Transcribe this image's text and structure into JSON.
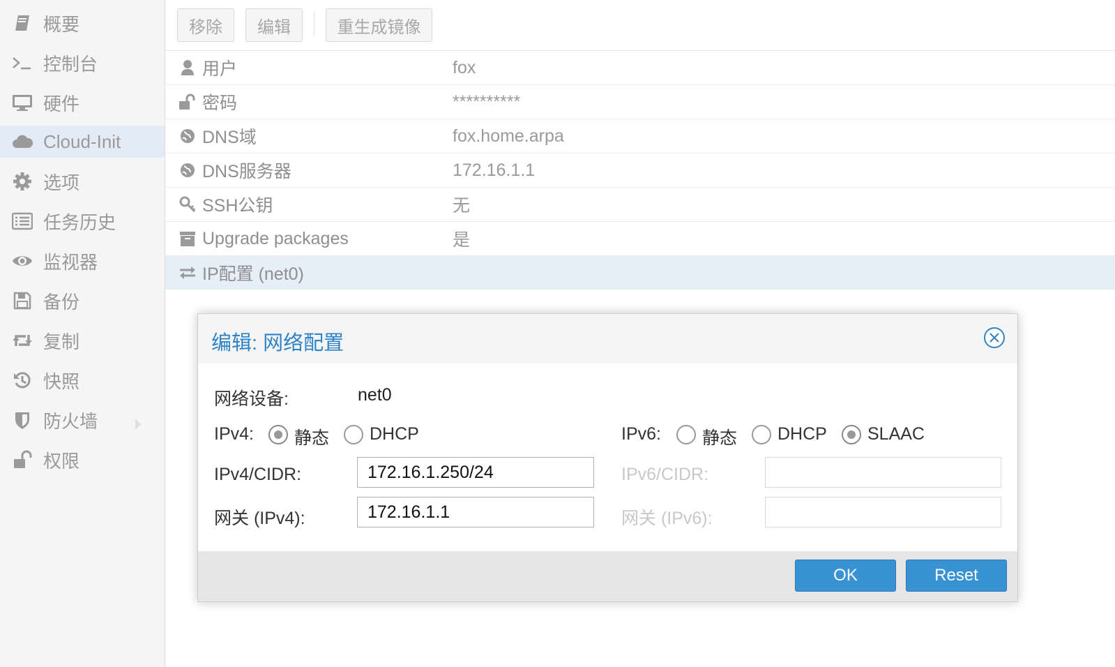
{
  "sidebar": {
    "items": [
      {
        "label": "概要",
        "icon": "book-icon"
      },
      {
        "label": "控制台",
        "icon": "terminal-icon"
      },
      {
        "label": "硬件",
        "icon": "monitor-icon"
      },
      {
        "label": "Cloud-Init",
        "icon": "cloud-icon",
        "active": true
      },
      {
        "label": "选项",
        "icon": "gear-icon"
      },
      {
        "label": "任务历史",
        "icon": "list-icon"
      },
      {
        "label": "监视器",
        "icon": "eye-icon"
      },
      {
        "label": "备份",
        "icon": "floppy-icon"
      },
      {
        "label": "复制",
        "icon": "retweet-icon"
      },
      {
        "label": "快照",
        "icon": "history-icon"
      },
      {
        "label": "防火墙",
        "icon": "shield-icon",
        "has_submenu": true
      },
      {
        "label": "权限",
        "icon": "unlock-icon"
      }
    ]
  },
  "toolbar": {
    "remove_label": "移除",
    "edit_label": "编辑",
    "regenerate_label": "重生成镜像"
  },
  "table": {
    "rows": [
      {
        "key": "用户",
        "value": "fox",
        "icon": "user-icon"
      },
      {
        "key": "密码",
        "value": "**********",
        "icon": "unlock-icon"
      },
      {
        "key": "DNS域",
        "value": "fox.home.arpa",
        "icon": "globe-icon"
      },
      {
        "key": "DNS服务器",
        "value": "172.16.1.1",
        "icon": "globe-icon"
      },
      {
        "key": "SSH公钥",
        "value": "无",
        "icon": "key-icon"
      },
      {
        "key": "Upgrade packages",
        "value": "是",
        "icon": "archive-icon"
      },
      {
        "key": "IP配置 (net0)",
        "value": "",
        "icon": "exchange-icon",
        "selected": true
      }
    ]
  },
  "dialog": {
    "title": "编辑: 网络配置",
    "network_device_label": "网络设备:",
    "network_device_value": "net0",
    "ipv4_label": "IPv4:",
    "ipv4_options": [
      "静态",
      "DHCP"
    ],
    "ipv4_selected": "静态",
    "ipv6_label": "IPv6:",
    "ipv6_options": [
      "静态",
      "DHCP",
      "SLAAC"
    ],
    "ipv6_selected": "SLAAC",
    "ipv4_cidr_label": "IPv4/CIDR:",
    "ipv4_cidr_value": "172.16.1.250/24",
    "gateway4_label": "网关 (IPv4):",
    "gateway4_value": "172.16.1.1",
    "ipv6_cidr_label": "IPv6/CIDR:",
    "ipv6_cidr_value": "",
    "gateway6_label": "网关 (IPv6):",
    "gateway6_value": "",
    "ok_label": "OK",
    "reset_label": "Reset"
  },
  "colors": {
    "accent": "#3892d4",
    "title": "#2f84c8",
    "selected_row": "#e6eef8"
  }
}
